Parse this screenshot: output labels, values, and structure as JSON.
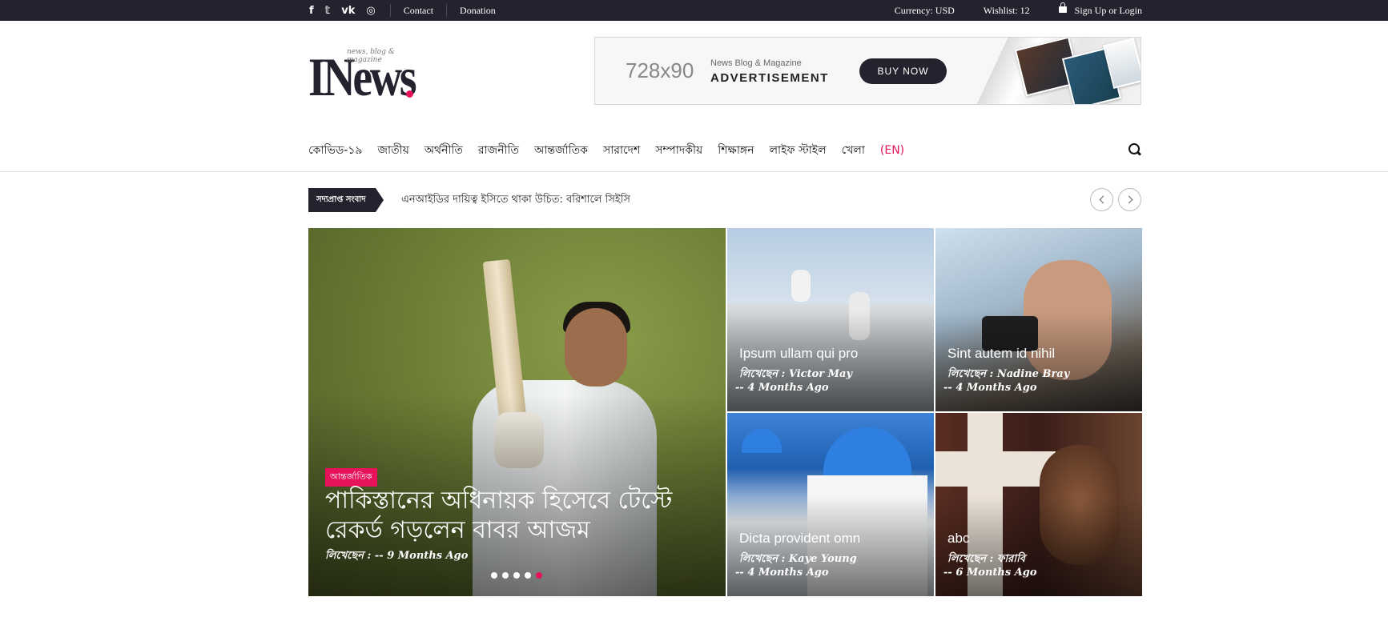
{
  "topbar": {
    "social": [
      {
        "icon": "facebook-icon",
        "glyph": "f"
      },
      {
        "icon": "twitter-icon",
        "glyph": "𝕥"
      },
      {
        "icon": "vk-icon",
        "glyph": "vk"
      },
      {
        "icon": "instagram-icon",
        "glyph": "◎"
      }
    ],
    "links": [
      "Contact",
      "Donation"
    ],
    "currency": "Currency: USD",
    "wishlist": "Wishlist: 12",
    "account": "Sign Up or Login"
  },
  "logo": {
    "word": "INews",
    "tagline": "news, blog & magazine"
  },
  "ad": {
    "size": "728x90",
    "subtitle": "News Blog & Magazine",
    "title": "ADVERTISEMENT",
    "button": "BUY NOW"
  },
  "nav": {
    "items": [
      "কোভিড-১৯",
      "জাতীয়",
      "অর্থনীতি",
      "রাজনীতি",
      "আন্তর্জাতিক",
      "সারাদেশ",
      "সম্পাদকীয়",
      "শিক্ষাঙ্গন",
      "লাইফ স্টাইল",
      "খেলা",
      "(EN)"
    ]
  },
  "ticker": {
    "label": "সদ্যপ্রাপ্ত সংবাদ",
    "text": "এনআইডির দায়িত্ব ইসিতে থাকা উচিত: বরিশালে সিইসি"
  },
  "hero": {
    "category": "আন্তর্জাতিক",
    "title": "পাকিস্তানের অধিনায়ক হিসেবে টেস্টে রেকর্ড গড়লেন বাবর আজম",
    "meta": "লিখেছেন : -- 9 Months Ago",
    "slides": 5,
    "active_slide": 5
  },
  "cards": [
    {
      "title": "Ipsum ullam qui pro",
      "author": "লিখেছেন : Victor May",
      "ago": "-- 4 Months Ago"
    },
    {
      "title": "Sint autem id nihil",
      "author": "লিখেছেন : Nadine Bray",
      "ago": "-- 4 Months Ago"
    },
    {
      "title": "Dicta provident omn",
      "author": "লিখেছেন : Kaye Young",
      "ago": "-- 4 Months Ago"
    },
    {
      "title": "abc",
      "author": "লিখেছেন : ফারাবি",
      "ago": "-- 6 Months Ago"
    }
  ],
  "colors": {
    "dark": "#23232f",
    "accent": "#e6135a"
  }
}
